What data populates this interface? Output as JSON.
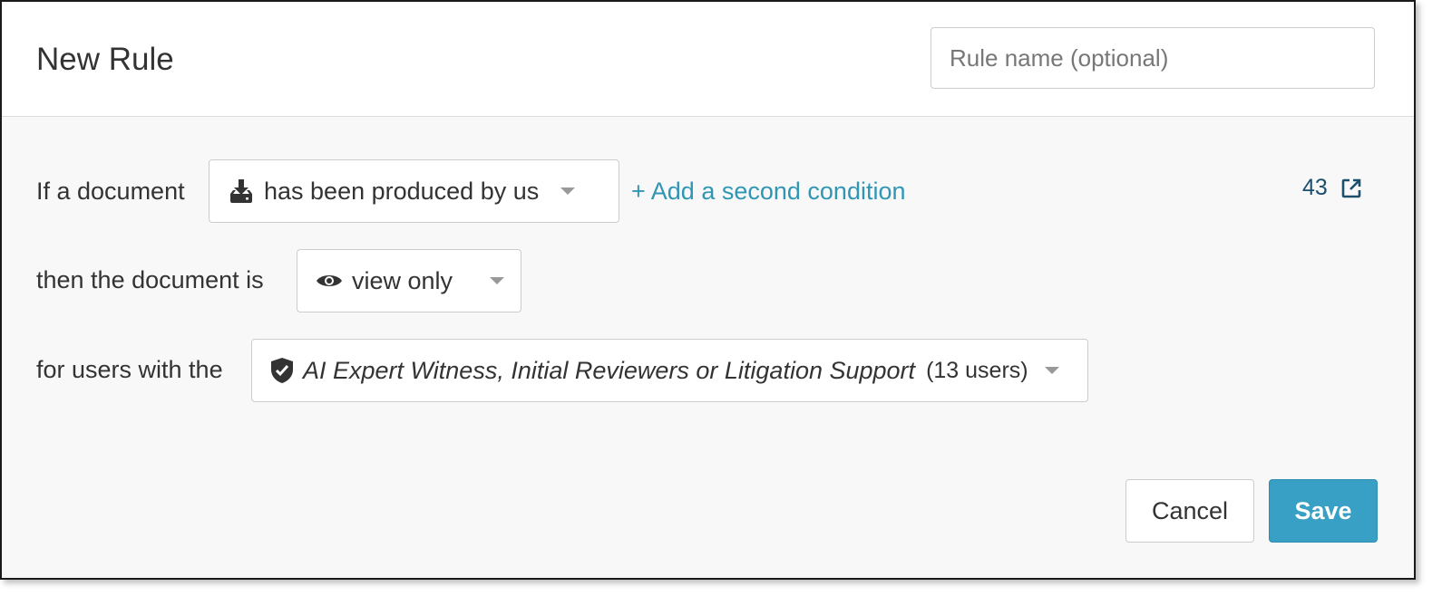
{
  "header": {
    "title": "New Rule",
    "rule_name_placeholder": "Rule name (optional)"
  },
  "condition": {
    "label": "If a document",
    "selected": "has been produced by us",
    "icon": "download-tray-icon",
    "add_condition_link": "+ Add a second condition",
    "matching_count": "43",
    "count_icon": "external-link-icon"
  },
  "permission": {
    "label": "then the document is",
    "selected": "view only",
    "icon": "eye-icon"
  },
  "roles": {
    "label": "for users with the",
    "selected": "AI Expert Witness, Initial Reviewers or Litigation Support",
    "user_count": "(13 users)",
    "icon": "shield-check-icon"
  },
  "footer": {
    "cancel_label": "Cancel",
    "save_label": "Save"
  },
  "colors": {
    "accent": "#37a0c4",
    "link": "#2f96b4",
    "count_text": "#1c4e6e",
    "body_background": "#f8f8f8"
  }
}
